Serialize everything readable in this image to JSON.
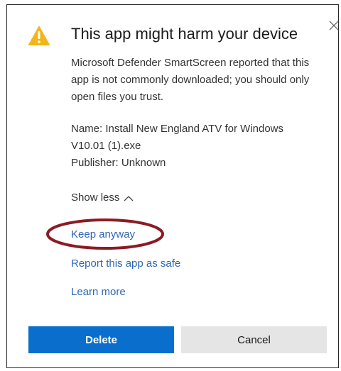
{
  "dialog": {
    "title": "This app might harm your device",
    "description": "Microsoft Defender SmartScreen reported that this app is not commonly downloaded; you should only open files you trust.",
    "details": {
      "name_line_1": "Name: Install New England ATV for Windows",
      "name_line_2": "V10.01 (1).exe",
      "publisher": "Publisher: Unknown"
    },
    "show_less_label": "Show less",
    "links": {
      "keep_anyway": "Keep anyway",
      "report_safe": "Report this app as safe",
      "learn_more": "Learn more"
    },
    "buttons": {
      "delete": "Delete",
      "cancel": "Cancel"
    }
  },
  "icons": {
    "warning": "warning-icon",
    "close": "close-icon",
    "chevron": "chevron-up-icon"
  },
  "colors": {
    "warning": "#f2b61a",
    "link": "#2f66b3",
    "primary_button": "#0a6fcc",
    "secondary_button": "#e5e5e5",
    "annotation_circle": "#8b1c24"
  }
}
